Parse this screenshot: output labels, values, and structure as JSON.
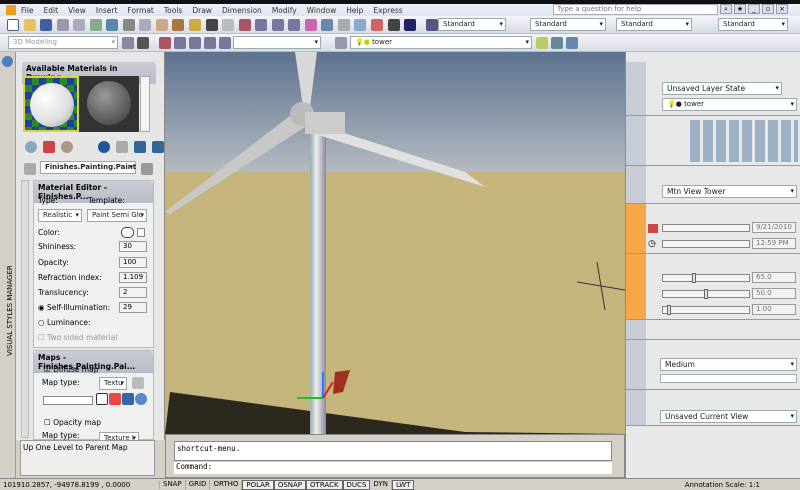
{
  "menu": [
    "File",
    "Edit",
    "View",
    "Insert",
    "Format",
    "Tools",
    "Draw",
    "Dimension",
    "Modify",
    "Window",
    "Help",
    "Express"
  ],
  "help_placeholder": "Type a question for help",
  "toolbar": {
    "styles": [
      "Standard",
      "Standard",
      "Standard",
      "Standard"
    ],
    "workspace": "3D Modeling",
    "layer": "tower"
  },
  "left": {
    "side_label": "VISUAL STYLES MANAGER",
    "materials_title": "Available Materials in Drawing",
    "material_name": "Finishes.Painting.Paint",
    "editor_title": "Material Editor - Finishes.P...",
    "type_label": "Type:",
    "template_label": "Template:",
    "type_value": "Realistic",
    "template_value": "Paint Semi Glo",
    "color_label": "Color:",
    "props": [
      {
        "label": "Shininess:",
        "value": "30"
      },
      {
        "label": "Opacity:",
        "value": "100"
      },
      {
        "label": "Refraction index:",
        "value": "1.109"
      },
      {
        "label": "Translucency:",
        "value": "2"
      },
      {
        "label": "Self-Illumination:",
        "value": "29"
      }
    ],
    "luminance": "Luminance:",
    "two_sided": "Two sided material",
    "maps_title": "Maps - Finishes.Painting.Pai...",
    "diffuse": "Diffuse map",
    "map_type": "Map type:",
    "map_type_value": "Textu",
    "opacity_map": "Opacity map",
    "map_type_value2": "Texture I",
    "tooltip": "Up One Level to Parent Map"
  },
  "right": {
    "layer_state": "Unsaved Layer State",
    "layer": "tower",
    "view_name": "Mtn View Tower",
    "date": "9/21/2010",
    "time": "12:59 PM",
    "intensity": "65.0",
    "contrast": "50.0",
    "midtones": "1.00",
    "intensity_pct": 0.35,
    "contrast_pct": 0.5,
    "midtones_pct": 0.05,
    "render_preset": "Medium",
    "current_view": "Unsaved Current View"
  },
  "command": {
    "history": "shortcut-menu.",
    "prompt": "Command:"
  },
  "status": {
    "coords": "101910.2857, -94978.8199 , 0.0000",
    "toggles": [
      "SNAP",
      "GRID",
      "ORTHO",
      "POLAR",
      "OSNAP",
      "OTRACK",
      "DUCS",
      "DYN",
      "LWT"
    ],
    "on": [
      "POLAR",
      "OSNAP",
      "OTRACK",
      "DUCS",
      "LWT"
    ],
    "annotation_label": "Annotation Scale:",
    "annotation_scale": "1:1"
  }
}
